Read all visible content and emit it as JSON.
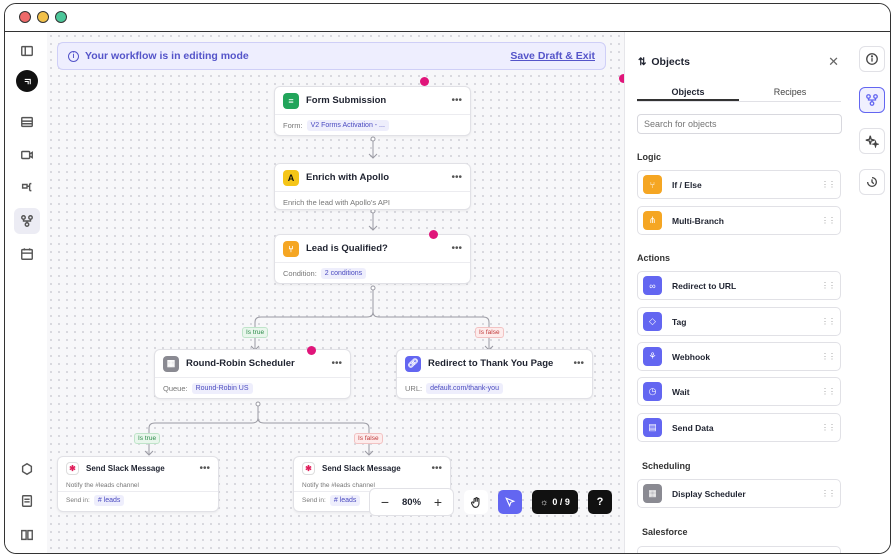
{
  "banner": {
    "message": "Your workflow is in editing mode",
    "action": "Save Draft & Exit"
  },
  "nodes": {
    "form": {
      "title": "Form Submission",
      "field_label": "Form:",
      "field_value": "V2 Forms Activation - ..."
    },
    "apollo": {
      "title": "Enrich with Apollo",
      "description": "Enrich the lead with Apollo's API"
    },
    "qualified": {
      "title": "Lead is Qualified?",
      "field_label": "Condition:",
      "field_value": "2 conditions"
    },
    "roundrobin": {
      "title": "Round-Robin Scheduler",
      "field_label": "Queue:",
      "field_value": "Round-Robin US"
    },
    "redirect": {
      "title": "Redirect to Thank You Page",
      "field_label": "URL:",
      "field_value": "default.com/thank-you"
    },
    "slack1": {
      "title": "Send Slack Message",
      "description": "Notify the #leads channel",
      "field_label": "Send in:",
      "field_value": "# leads"
    },
    "slack2": {
      "title": "Send Slack Message",
      "description": "Notify the #leads channel",
      "field_label": "Send in:",
      "field_value": "# leads"
    }
  },
  "branch_labels": {
    "true": "Is true",
    "false": "Is false"
  },
  "menu_dots": "•••",
  "toolbar": {
    "zoom": "80%",
    "zoom_out": "−",
    "zoom_in": "+",
    "tips": "0 / 9",
    "help": "?"
  },
  "panel": {
    "title": "Objects",
    "close": "✕",
    "tabs": [
      "Objects",
      "Recipes"
    ],
    "search_placeholder": "Search for objects",
    "sections": {
      "logic": "Logic",
      "actions": "Actions",
      "scheduling": "Scheduling",
      "salesforce": "Salesforce"
    },
    "logic_items": [
      "If / Else",
      "Multi-Branch"
    ],
    "action_items": [
      "Redirect to URL",
      "Tag",
      "Webhook",
      "Wait",
      "Send Data"
    ],
    "scheduling_items": [
      "Display Scheduler"
    ],
    "grip": "⋮⋮"
  },
  "colors": {
    "accent": "#6366f1",
    "banner_bg": "#eeeefe",
    "logic_orange": "#f5a623",
    "action_purple": "#6366f1",
    "pink_dot": "#e0157a",
    "form_green": "#22a55b"
  },
  "icons": {
    "sidebar": [
      "panel-icon",
      "logo-icon",
      "table-icon",
      "video-icon",
      "routing-icon",
      "workflow-icon",
      "calendar-icon",
      "cube-icon",
      "document-icon",
      "book-icon"
    ],
    "rail": [
      "info-icon",
      "workflow-icon",
      "sparkles-icon",
      "history-icon"
    ]
  }
}
